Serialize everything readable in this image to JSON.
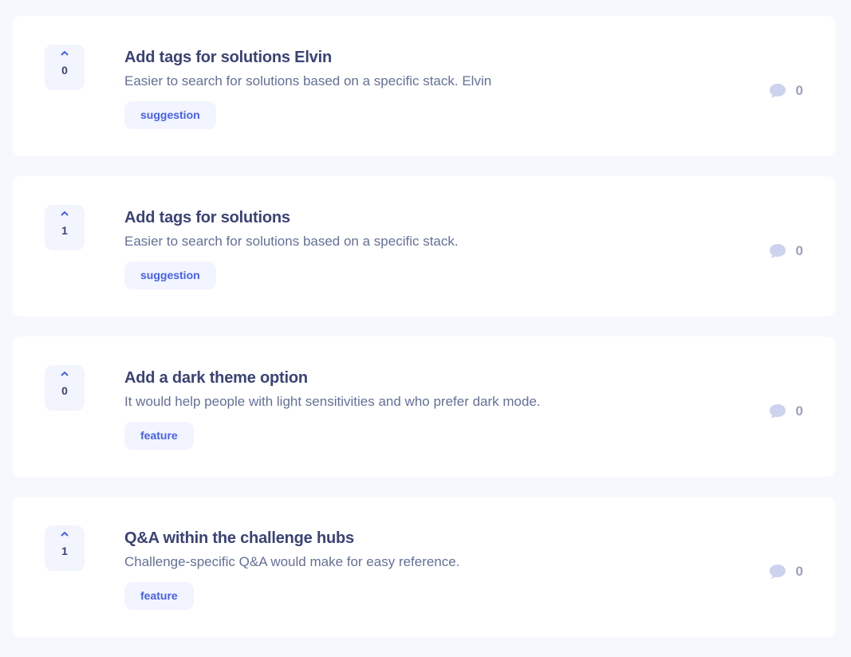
{
  "colors": {
    "page_background": "#f7f8fd",
    "card_background": "#ffffff",
    "title": "#3a4374",
    "description": "#647196",
    "tag_background": "#f2f4ff",
    "tag_text": "#4661e6",
    "upvote_background": "#f2f4fe",
    "chevron": "#4661e6",
    "comment_icon": "#cdd2ee"
  },
  "icons": {
    "upvote": "chevron-up-icon",
    "comments": "speech-bubble-icon"
  },
  "feedback": [
    {
      "upvotes": "0",
      "title": "Add tags for solutions Elvin",
      "description": "Easier to search for solutions based on a specific stack. Elvin",
      "tag": "suggestion",
      "comments": "0"
    },
    {
      "upvotes": "1",
      "title": "Add tags for solutions",
      "description": "Easier to search for solutions based on a specific stack.",
      "tag": "suggestion",
      "comments": "0"
    },
    {
      "upvotes": "0",
      "title": "Add a dark theme option",
      "description": "It would help people with light sensitivities and who prefer dark mode.",
      "tag": "feature",
      "comments": "0"
    },
    {
      "upvotes": "1",
      "title": "Q&A within the challenge hubs",
      "description": "Challenge-specific Q&A would make for easy reference.",
      "tag": "feature",
      "comments": "0"
    }
  ]
}
